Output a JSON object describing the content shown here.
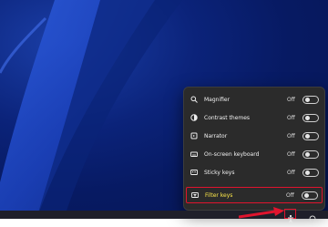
{
  "accessibility_panel": {
    "items": [
      {
        "label": "Magnifier",
        "state": "Off",
        "icon": "magnifier-icon"
      },
      {
        "label": "Contrast themes",
        "state": "Off",
        "icon": "contrast-icon"
      },
      {
        "label": "Narrator",
        "state": "Off",
        "icon": "narrator-icon"
      },
      {
        "label": "On-screen keyboard",
        "state": "Off",
        "icon": "keyboard-icon"
      },
      {
        "label": "Sticky keys",
        "state": "Off",
        "icon": "sticky-keys-icon"
      },
      {
        "label": "Filter keys",
        "state": "Off",
        "icon": "filter-keys-icon",
        "highlighted": true
      }
    ]
  },
  "colors": {
    "highlight_border": "#e0142e",
    "highlight_text": "#ffe94a",
    "panel_bg": "#2b2b2b"
  }
}
